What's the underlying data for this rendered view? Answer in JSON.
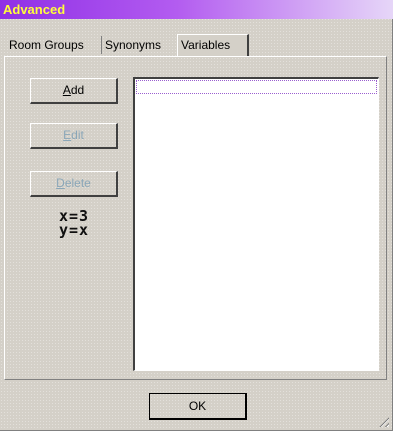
{
  "window": {
    "title": "Advanced"
  },
  "tabs": [
    {
      "label": "Room Groups",
      "selected": false
    },
    {
      "label": "Synonyms",
      "selected": false
    },
    {
      "label": "Variables",
      "selected": true
    }
  ],
  "buttons": {
    "add": {
      "prefix": "",
      "mnemonic": "A",
      "rest": "dd",
      "enabled": true
    },
    "edit": {
      "prefix": "",
      "mnemonic": "E",
      "rest": "dit",
      "enabled": false
    },
    "delete": {
      "prefix": "",
      "mnemonic": "D",
      "rest": "elete",
      "enabled": false
    }
  },
  "variables": [
    "x=3",
    "y=x"
  ],
  "variable_list": {
    "items": []
  },
  "ok_label": "OK",
  "colors": {
    "title_text": "#ffff3a",
    "title_bar": "#8f2fe6",
    "disabled_text": "#8aa6b8",
    "face": "#d4d0c8"
  }
}
